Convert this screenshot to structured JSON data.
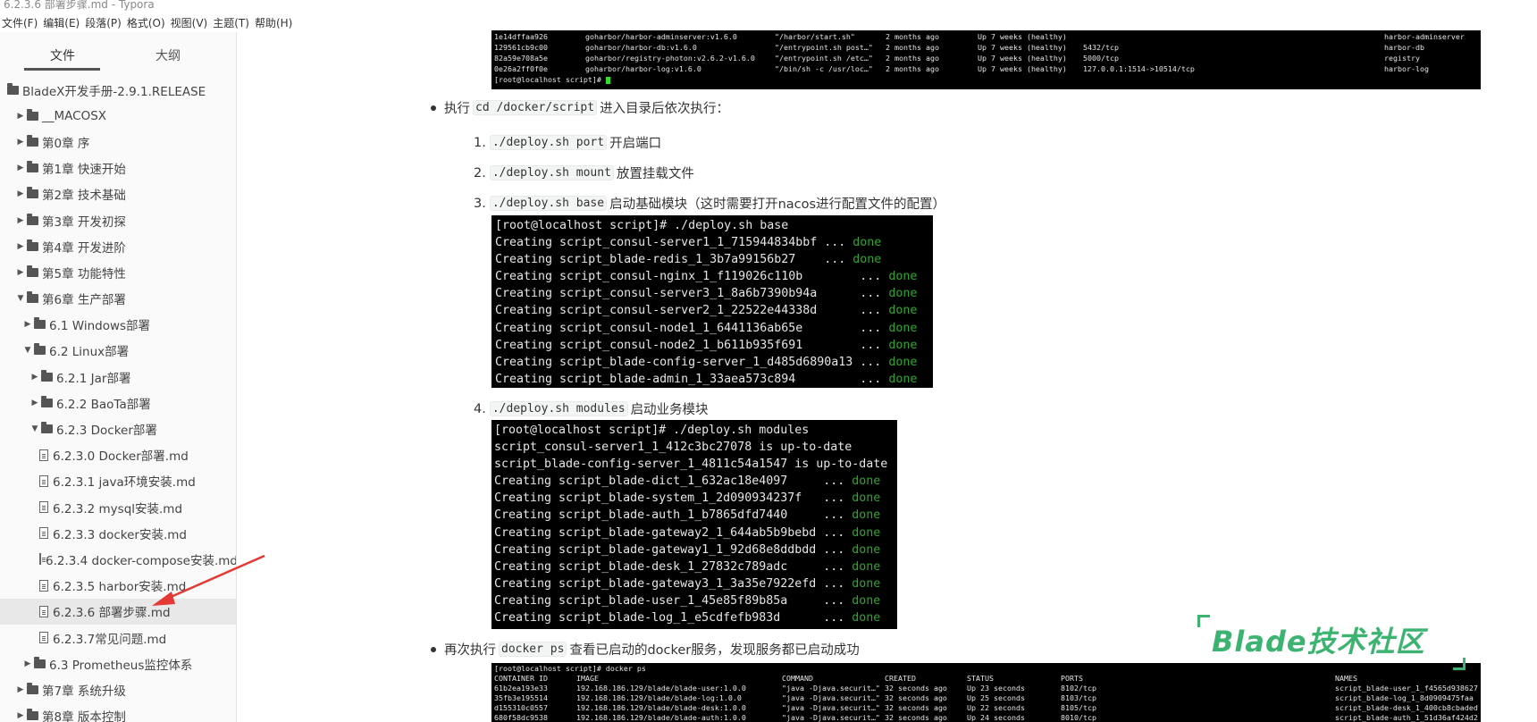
{
  "window": {
    "title": "6.2.3.6 部署步骤.md - Typora"
  },
  "menu": [
    "文件(F)",
    "编辑(E)",
    "段落(P)",
    "格式(O)",
    "视图(V)",
    "主题(T)",
    "帮助(H)"
  ],
  "sidebar": {
    "tabs": {
      "files": "文件",
      "outline": "大纲"
    },
    "tree": [
      {
        "label": "BladeX开发手册-2.9.1.RELEASE",
        "type": "folder",
        "indent": 0,
        "caret": ""
      },
      {
        "label": "__MACOSX",
        "type": "folder",
        "indent": 1,
        "caret": "▶"
      },
      {
        "label": "第0章 序",
        "type": "folder",
        "indent": 1,
        "caret": "▶"
      },
      {
        "label": "第1章 快速开始",
        "type": "folder",
        "indent": 1,
        "caret": "▶"
      },
      {
        "label": "第2章 技术基础",
        "type": "folder",
        "indent": 1,
        "caret": "▶"
      },
      {
        "label": "第3章 开发初探",
        "type": "folder",
        "indent": 1,
        "caret": "▶"
      },
      {
        "label": "第4章 开发进阶",
        "type": "folder",
        "indent": 1,
        "caret": "▶"
      },
      {
        "label": "第5章 功能特性",
        "type": "folder",
        "indent": 1,
        "caret": "▶"
      },
      {
        "label": "第6章 生产部署",
        "type": "folder",
        "indent": 1,
        "caret": "▼"
      },
      {
        "label": "6.1 Windows部署",
        "type": "folder",
        "indent": 2,
        "caret": "▶"
      },
      {
        "label": "6.2 Linux部署",
        "type": "folder",
        "indent": 2,
        "caret": "▼"
      },
      {
        "label": "6.2.1 Jar部署",
        "type": "folder",
        "indent": 3,
        "caret": "▶"
      },
      {
        "label": "6.2.2 BaoTa部署",
        "type": "folder",
        "indent": 3,
        "caret": "▶"
      },
      {
        "label": "6.2.3 Docker部署",
        "type": "folder",
        "indent": 3,
        "caret": "▼"
      },
      {
        "label": "6.2.3.0 Docker部署.md",
        "type": "file",
        "indent": 4,
        "caret": ""
      },
      {
        "label": "6.2.3.1 java环境安装.md",
        "type": "file",
        "indent": 4,
        "caret": ""
      },
      {
        "label": "6.2.3.2 mysql安装.md",
        "type": "file",
        "indent": 4,
        "caret": ""
      },
      {
        "label": "6.2.3.3 docker安装.md",
        "type": "file",
        "indent": 4,
        "caret": ""
      },
      {
        "label": "6.2.3.4 docker-compose安装.md",
        "type": "file",
        "indent": 4,
        "caret": ""
      },
      {
        "label": "6.2.3.5 harbor安装.md",
        "type": "file",
        "indent": 4,
        "caret": ""
      },
      {
        "label": "6.2.3.6 部署步骤.md",
        "type": "file",
        "indent": 4,
        "caret": "",
        "selected": true
      },
      {
        "label": "6.2.3.7常见问题.md",
        "type": "file",
        "indent": 4,
        "caret": ""
      },
      {
        "label": "6.3 Prometheus监控体系",
        "type": "folder",
        "indent": 2,
        "caret": "▶"
      },
      {
        "label": "第7章 系统升级",
        "type": "folder",
        "indent": 1,
        "caret": "▶"
      },
      {
        "label": "第8章 版本控制",
        "type": "folder",
        "indent": 1,
        "caret": "▶"
      }
    ]
  },
  "content": {
    "term_top": [
      [
        "1e14dffaa926",
        "goharbor/harbor-adminserver:v1.6.0",
        "\"/harbor/start.sh\"",
        "2 months ago",
        "Up 7 weeks (healthy)",
        "",
        "harbor-adminserver"
      ],
      [
        "129561cb9c00",
        "goharbor/harbor-db:v1.6.0",
        "\"/entrypoint.sh post…\"",
        "2 months ago",
        "Up 7 weeks (healthy)",
        "5432/tcp",
        "harbor-db"
      ],
      [
        "82a59e708a5e",
        "goharbor/registry-photon:v2.6.2-v1.6.0",
        "\"/entrypoint.sh /etc…\"",
        "2 months ago",
        "Up 7 weeks (healthy)",
        "5000/tcp",
        "registry"
      ],
      [
        "0e26a2ff0f0e",
        "goharbor/harbor-log:v1.6.0",
        "\"/bin/sh -c /usr/loc…\"",
        "2 months ago",
        "Up 7 weeks (healthy)",
        "127.0.0.1:1514->10514/tcp",
        "harbor-log"
      ]
    ],
    "term_top_prompt": "[root@localhost script]# ",
    "bullet1": {
      "pre": "执行",
      "code": "cd /docker/script",
      "post": "进入目录后依次执行："
    },
    "steps": [
      {
        "num": "1.",
        "code": "./deploy.sh port",
        "text": "开启端口"
      },
      {
        "num": "2.",
        "code": "./deploy.sh mount",
        "text": "放置挂载文件"
      },
      {
        "num": "3.",
        "code": "./deploy.sh base",
        "text": "启动基础模块（这时需要打开nacos进行配置文件的配置）"
      },
      {
        "num": "4.",
        "code": "./deploy.sh modules",
        "text": "启动业务模块"
      }
    ],
    "term_base": {
      "prompt": "[root@localhost script]# ./deploy.sh base",
      "lines": [
        [
          "Creating script_consul-server1_1_715944834bbf ... ",
          "done"
        ],
        [
          "Creating script_blade-redis_1_3b7a99156b27    ... ",
          "done"
        ],
        [
          "Creating script_consul-nginx_1_f119026c110b        ... ",
          "done"
        ],
        [
          "Creating script_consul-server3_1_8a6b7390b94a      ... ",
          "done"
        ],
        [
          "Creating script_consul-server2_1_22522e44338d      ... ",
          "done"
        ],
        [
          "Creating script_consul-node1_1_6441136ab65e        ... ",
          "done"
        ],
        [
          "Creating script_consul-node2_1_b611b935f691        ... ",
          "done"
        ],
        [
          "Creating script_blade-config-server_1_d485d6890a13 ... ",
          "done"
        ],
        [
          "Creating script_blade-admin_1_33aea573c894         ... ",
          "done"
        ]
      ]
    },
    "term_modules": {
      "prompt": "[root@localhost script]# ./deploy.sh modules",
      "uptodate": [
        "script_consul-server1_1_412c3bc27078 is up-to-date",
        "script_blade-config-server_1_4811c54a1547 is up-to-date"
      ],
      "lines": [
        [
          "Creating script_blade-dict_1_632ac18e4097     ... ",
          "done"
        ],
        [
          "Creating script_blade-system_1_2d090934237f   ... ",
          "done"
        ],
        [
          "Creating script_blade-auth_1_b7865dfd7440     ... ",
          "done"
        ],
        [
          "Creating script_blade-gateway2_1_644ab5b9bebd ... ",
          "done"
        ],
        [
          "Creating script_blade-gateway1_1_92d68e8ddbdd ... ",
          "done"
        ],
        [
          "Creating script_blade-desk_1_27832c789adc     ... ",
          "done"
        ],
        [
          "Creating script_blade-gateway3_1_3a35e7922efd ... ",
          "done"
        ],
        [
          "Creating script_blade-user_1_45e85f89b85a     ... ",
          "done"
        ],
        [
          "Creating script_blade-log_1_e5cdfefb983d      ... ",
          "done"
        ]
      ]
    },
    "bullet2": {
      "pre": "再次执行",
      "code": "docker ps",
      "post": "查看已启动的docker服务，发现服务都已启动成功"
    },
    "term_bottom": {
      "prompt": "[root@localhost script]# docker ps",
      "header": [
        "CONTAINER ID",
        "IMAGE",
        "COMMAND",
        "CREATED",
        "STATUS",
        "PORTS",
        "NAMES"
      ],
      "rows": [
        [
          "61b2ea193e33",
          "192.168.186.129/blade/blade-user:1.0.0",
          "\"java -Djava.securit…\"",
          "32 seconds ago",
          "Up 23 seconds",
          "8102/tcp",
          "script_blade-user_1_f4565d938627"
        ],
        [
          "35fb3e195514",
          "192.168.186.129/blade/blade-log:1.0.0",
          "\"java -Djava.securit…\"",
          "32 seconds ago",
          "Up 25 seconds",
          "8103/tcp",
          "script_blade-log_1_8d0909475faa"
        ],
        [
          "d155310c0557",
          "192.168.186.129/blade/blade-desk:1.0.0",
          "\"java -Djava.securit…\"",
          "32 seconds ago",
          "Up 22 seconds",
          "8105/tcp",
          "script_blade-desk_1_400cb8cbaded"
        ],
        [
          "680f58dc9538",
          "192.168.186.129/blade/blade-auth:1.0.0",
          "\"java -Djava.securit…\"",
          "32 seconds ago",
          "Up 24 seconds",
          "8010/tcp",
          "script_blade-auth_1_51d36af424d2"
        ]
      ]
    },
    "watermark": "Blade技术社区"
  },
  "colors": {
    "done": "#2fa52f",
    "watermark": "#3cb371",
    "arrow": "#e53935"
  }
}
